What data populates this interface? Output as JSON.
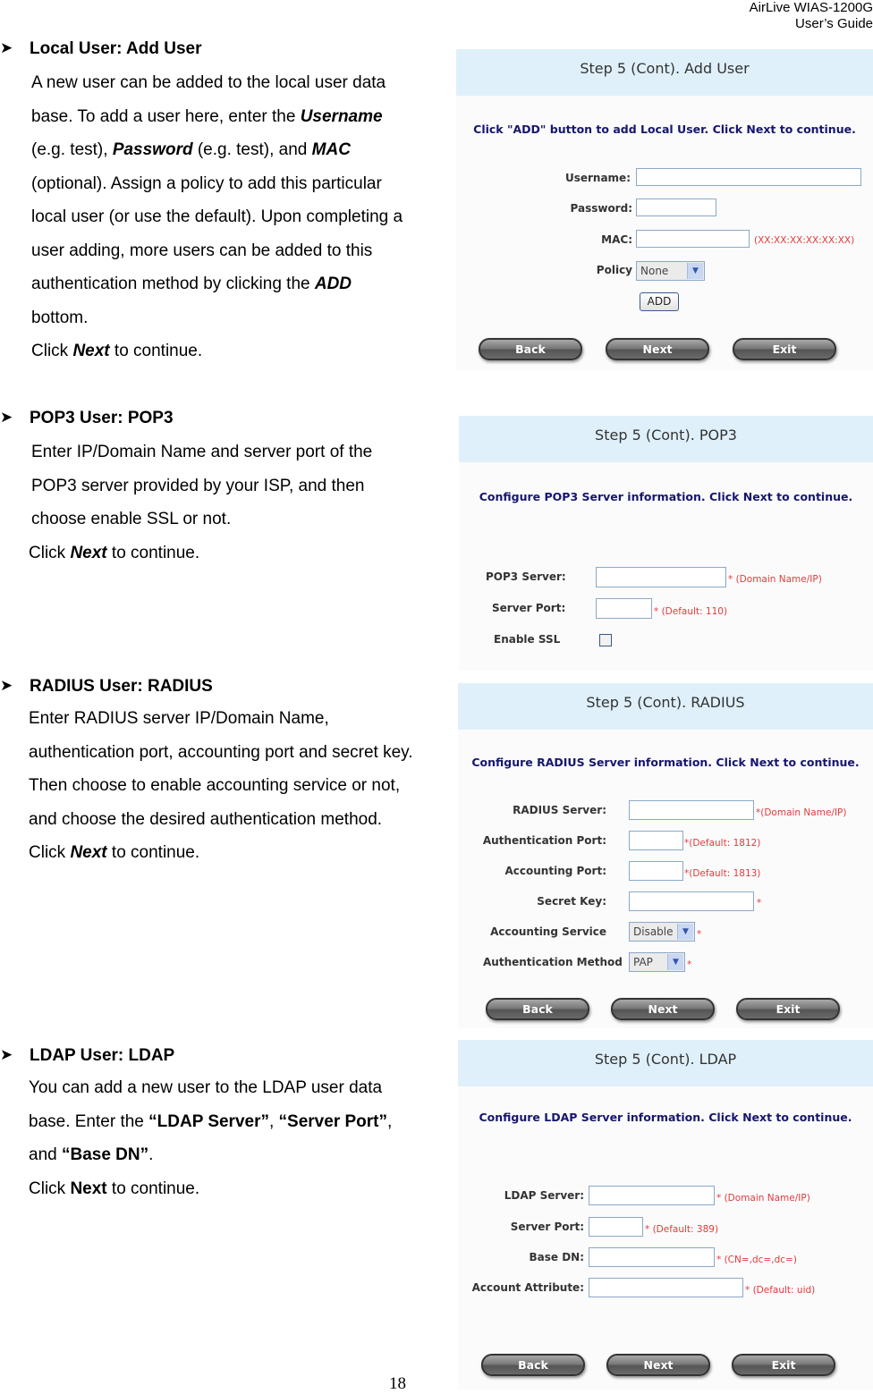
{
  "header": {
    "product": "AirLive  WIAS-1200G",
    "guide": "User’s  Guide"
  },
  "page_number": "18",
  "bullet_icon": "arrowhead-bullet-icon",
  "sections": {
    "local": {
      "title": "Local User: Add User",
      "lines": [
        [
          "A new user can be added to the local user data"
        ],
        [
          "base. To add a user here, enter the ",
          "Username"
        ],
        [
          "(e.g. test), ",
          "Password",
          " (e.g. test), and ",
          "MAC"
        ],
        [
          "(optional). Assign a policy to add this particular"
        ],
        [
          "local user (or use the default). Upon completing a"
        ],
        [
          "user adding, more users can be added to this"
        ],
        [
          "authentication method by clicking the ",
          "ADD"
        ],
        [
          "bottom."
        ],
        [
          "Click ",
          "Next",
          " to continue."
        ]
      ]
    },
    "pop3": {
      "title": "POP3 User: POP3",
      "lines": [
        [
          "Enter IP/Domain Name and server port of the"
        ],
        [
          "POP3 server provided by your ISP, and then"
        ],
        [
          "choose enable SSL or not."
        ],
        [
          "Click ",
          "Next",
          " to continue."
        ]
      ]
    },
    "radius": {
      "title": "RADIUS User: RADIUS",
      "lines": [
        [
          "Enter RADIUS server IP/Domain Name,"
        ],
        [
          "authentication port, accounting port and secret key."
        ],
        [
          "Then choose to enable accounting service or not,"
        ],
        [
          "and choose the desired authentication method."
        ],
        [
          "Click ",
          "Next",
          " to continue."
        ]
      ]
    },
    "ldap": {
      "title": "LDAP User: LDAP",
      "lines": [
        [
          "You can add a new user to the LDAP user data"
        ],
        [
          "base. Enter the ",
          "“LDAP Server”",
          ", ",
          "“Server Port”",
          ","
        ],
        [
          "and ",
          "“Base DN”",
          "."
        ],
        [
          "Click ",
          "Next",
          " to continue."
        ]
      ]
    }
  },
  "panels": {
    "local": {
      "title": "Step 5 (Cont). Add User",
      "instruction": "Click \"ADD\" button to add Local User. Click Next to continue.",
      "fields": {
        "username": {
          "label": "Username:",
          "value": ""
        },
        "password": {
          "label": "Password:",
          "value": ""
        },
        "mac": {
          "label": "MAC:",
          "value": "",
          "hint": "(XX:XX:XX:XX:XX:XX)"
        },
        "policy": {
          "label": "Policy",
          "selected": "None"
        }
      },
      "add_button": "ADD"
    },
    "pop3": {
      "title": "Step 5 (Cont). POP3",
      "instruction": "Configure POP3 Server information. Click Next to continue.",
      "fields": {
        "server": {
          "label": "POP3 Server:",
          "value": "",
          "hint": "* (Domain Name/IP)"
        },
        "port": {
          "label": "Server Port:",
          "value": "",
          "hint": "* (Default: 110)"
        },
        "ssl": {
          "label": "Enable SSL",
          "checked": false
        }
      }
    },
    "radius": {
      "title": "Step 5 (Cont). RADIUS",
      "instruction": "Configure RADIUS Server information. Click Next to continue.",
      "fields": {
        "server": {
          "label": "RADIUS Server:",
          "value": "",
          "hint": "*(Domain Name/IP)"
        },
        "auth_port": {
          "label": "Authentication Port:",
          "value": "",
          "hint": "*(Default: 1812)"
        },
        "acct_port": {
          "label": "Accounting Port:",
          "value": "",
          "hint": "*(Default: 1813)"
        },
        "secret": {
          "label": "Secret Key:",
          "value": "",
          "hint": "*"
        },
        "acct_service": {
          "label": "Accounting Service",
          "selected": "Disable",
          "hint": "*"
        },
        "auth_method": {
          "label": "Authentication Method",
          "selected": "PAP",
          "hint": "*"
        }
      }
    },
    "ldap": {
      "title": "Step 5 (Cont). LDAP",
      "instruction": "Configure LDAP Server information. Click Next to continue.",
      "fields": {
        "server": {
          "label": "LDAP Server:",
          "value": "",
          "hint": "* (Domain Name/IP)"
        },
        "port": {
          "label": "Server Port:",
          "value": "",
          "hint": "* (Default: 389)"
        },
        "base_dn": {
          "label": "Base DN:",
          "value": "",
          "hint": "* (CN=,dc=,dc=)"
        },
        "account_attr": {
          "label": "Account Attribute:",
          "value": "",
          "hint": "* (Default: uid)"
        }
      }
    }
  },
  "nav_buttons": {
    "back": "Back",
    "next": "Next",
    "exit": "Exit"
  }
}
